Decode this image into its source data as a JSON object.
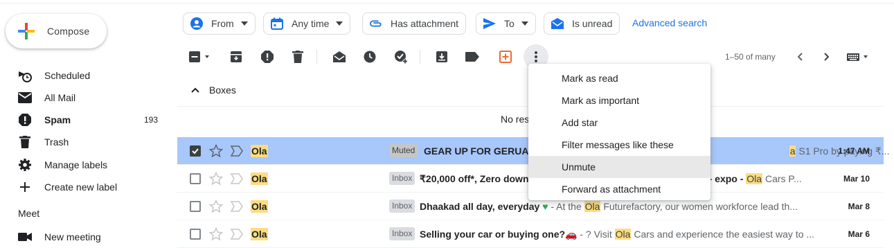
{
  "compose": {
    "label": "Compose"
  },
  "sidebar": {
    "items": [
      {
        "label": "Scheduled",
        "icon": "scheduled-icon",
        "count": ""
      },
      {
        "label": "All Mail",
        "icon": "mail-icon",
        "count": ""
      },
      {
        "label": "Spam",
        "icon": "spam-icon",
        "count": "193"
      },
      {
        "label": "Trash",
        "icon": "trash-icon",
        "count": ""
      },
      {
        "label": "Manage labels",
        "icon": "gear-icon",
        "count": ""
      },
      {
        "label": "Create new label",
        "icon": "plus-icon",
        "count": ""
      }
    ],
    "meet_title": "Meet",
    "meet_items": [
      {
        "label": "New meeting",
        "icon": "video-camera-icon"
      }
    ]
  },
  "filters": {
    "chips": [
      {
        "label": "From",
        "icon": "person-icon",
        "dropdown": true
      },
      {
        "label": "Any time",
        "icon": "calendar-icon",
        "dropdown": true
      },
      {
        "label": "Has attachment",
        "icon": "attachment-icon",
        "dropdown": false
      },
      {
        "label": "To",
        "icon": "send-icon",
        "dropdown": true
      },
      {
        "label": "Is unread",
        "icon": "unread-icon",
        "dropdown": false
      }
    ],
    "advanced": "Advanced search"
  },
  "toolbar": {
    "pagination": "1–50 of many"
  },
  "section": {
    "title": "Boxes",
    "no_results": "No res"
  },
  "rows": [
    {
      "selected": true,
      "sender": "Ola",
      "tag": "Muted",
      "subject": "GEAR UP FOR GERUA O",
      "snippet_hl": "a",
      "snippet": " S1 Pro by paying ₹...",
      "date": "1:47 AM"
    },
    {
      "selected": false,
      "sender": "Ola",
      "tag": "Inbox",
      "subject": "₹20,000 off*, Zero down",
      "snippet_pre": "o! - expo - ",
      "snippet_hl": "Ola",
      "snippet": " Cars P...",
      "date": "Mar 10"
    },
    {
      "selected": false,
      "sender": "Ola",
      "tag": "Inbox",
      "subject": "Dhaakad all day, everyday",
      "snippet_pre": " - At the ",
      "snippet_hl": "Ola",
      "snippet": " Futurefactory, our women workforce lead th...",
      "date": "Mar 8"
    },
    {
      "selected": false,
      "sender": "Ola",
      "tag": "Inbox",
      "subject": "Selling your car or buying one?🚗",
      "snippet_pre": " - ? Visit ",
      "snippet_hl": "Ola",
      "snippet": " Cars and experience the easiest way to ...",
      "date": "Mar 6"
    }
  ],
  "menu": {
    "items": [
      "Mark as read",
      "Mark as important",
      "Add star",
      "Filter messages like these",
      "Unmute",
      "Forward as attachment"
    ],
    "hovered_index": 4
  },
  "colors": {
    "accent": "#1a73e8",
    "selected_row": "#a8c7fa",
    "highlight": "#fddc80"
  }
}
